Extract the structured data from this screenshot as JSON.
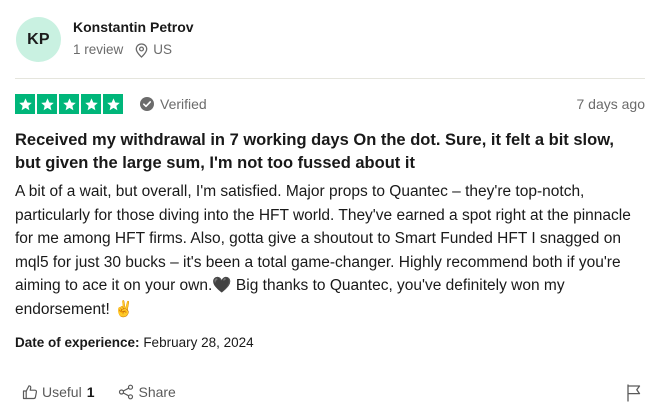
{
  "reviewer": {
    "initials": "KP",
    "name": "Konstantin Petrov",
    "review_count": "1 review",
    "country": "US"
  },
  "review": {
    "rating": 5,
    "verified_label": "Verified",
    "date": "7 days ago",
    "title": "Received my withdrawal in 7 working days On the dot. Sure, it felt a bit slow, but given the large sum, I'm not too fussed about it",
    "body_part1": "A bit of a wait, but overall, I'm satisfied. Major props to Quantec – they're top-notch, particularly for those diving into the HFT world. They've earned a spot right at the pinnacle for me among HFT firms. Also, gotta give a shoutout to Smart Funded HFT I snagged on mql5 for just 30 bucks – it's been a total game-changer. Highly recommend both if you're aiming to ace it on your own.",
    "heart_emoji": "🖤",
    "body_part2": " Big thanks to Quantec, you've definitely won my endorsement! ",
    "hand_emoji": "✌️",
    "experience_label": "Date of experience:",
    "experience_date": "February 28, 2024"
  },
  "actions": {
    "useful_label": "Useful",
    "useful_count": "1",
    "share_label": "Share"
  },
  "colors": {
    "star_green": "#00b67a",
    "avatar_bg": "#c9f1e1",
    "muted_text": "#6b6b6b"
  },
  "icons": {
    "location": "location-pin-icon",
    "verified": "verified-check-icon",
    "useful": "thumbs-up-icon",
    "share": "share-icon",
    "report": "flag-icon"
  }
}
